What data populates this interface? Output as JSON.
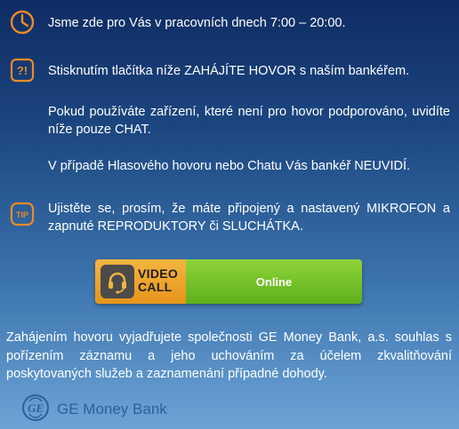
{
  "info": {
    "hours_text": "Jsme zde pro Vás v pracovních dnech 7:00 – 20:00.",
    "alert_icon_text": "?!",
    "start_call_text": "Stisknutím tlačítka níže ZAHÁJÍTE HOVOR s naším bankéřem.",
    "unsupported_device_text": "Pokud používáte zařízení, které není pro hovor podporováno, uvidíte níže pouze CHAT.",
    "not_visible_text": "V případě Hlasového hovoru nebo Chatu Vás bankéř NEUVIDÍ.",
    "tip_icon_text": "TIP",
    "tip_text": "Ujistěte se, prosím, že máte připojený a nastavený MIKROFON a zapnuté REPRODUKTORY či SLUCHÁTKA."
  },
  "call_button": {
    "video_label_line1": "VIDEO",
    "video_label_line2": "CALL",
    "status_label": "Online"
  },
  "consent_text": "Zahájením hovoru vyjadřujete společnosti GE Money Bank, a.s. souhlas s pořízením záznamu a jeho uchováním za účelem zkvalitňování poskytovaných služeb a zaznamenání případné dohody.",
  "footer": {
    "logo_text": "GE",
    "brand_name": "GE Money Bank"
  },
  "colors": {
    "icon_orange": "#e98b28",
    "video_call_orange": "#f4b540",
    "online_green": "#6cc024",
    "brand_blue": "#2f5f99"
  }
}
